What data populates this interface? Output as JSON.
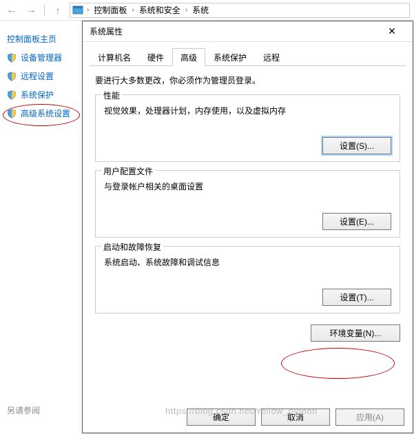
{
  "breadcrumb": {
    "items": [
      "控制面板",
      "系统和安全",
      "系统"
    ]
  },
  "left": {
    "home": "控制面板主页",
    "links": [
      "设备管理器",
      "远程设置",
      "系统保护",
      "高级系统设置"
    ],
    "see_also": "另请参阅"
  },
  "dialog": {
    "title": "系统属性",
    "close": "✕",
    "tabs": [
      "计算机名",
      "硬件",
      "高级",
      "系统保护",
      "远程"
    ],
    "active_tab_index": 2,
    "admin_note": "要进行大多数更改，你必须作为管理员登录。",
    "groups": [
      {
        "title": "性能",
        "desc": "视觉效果，处理器计划，内存使用，以及虚拟内存",
        "button": "设置(S)..."
      },
      {
        "title": "用户配置文件",
        "desc": "与登录帐户相关的桌面设置",
        "button": "设置(E)..."
      },
      {
        "title": "启动和故障恢复",
        "desc": "系统启动、系统故障和调试信息",
        "button": "设置(T)..."
      }
    ],
    "env_button": "环境变量(N)...",
    "buttons": {
      "ok": "确定",
      "cancel": "取消",
      "apply": "应用(A)"
    }
  },
  "watermark": "https://blog.csdn.net/Yellow_python"
}
